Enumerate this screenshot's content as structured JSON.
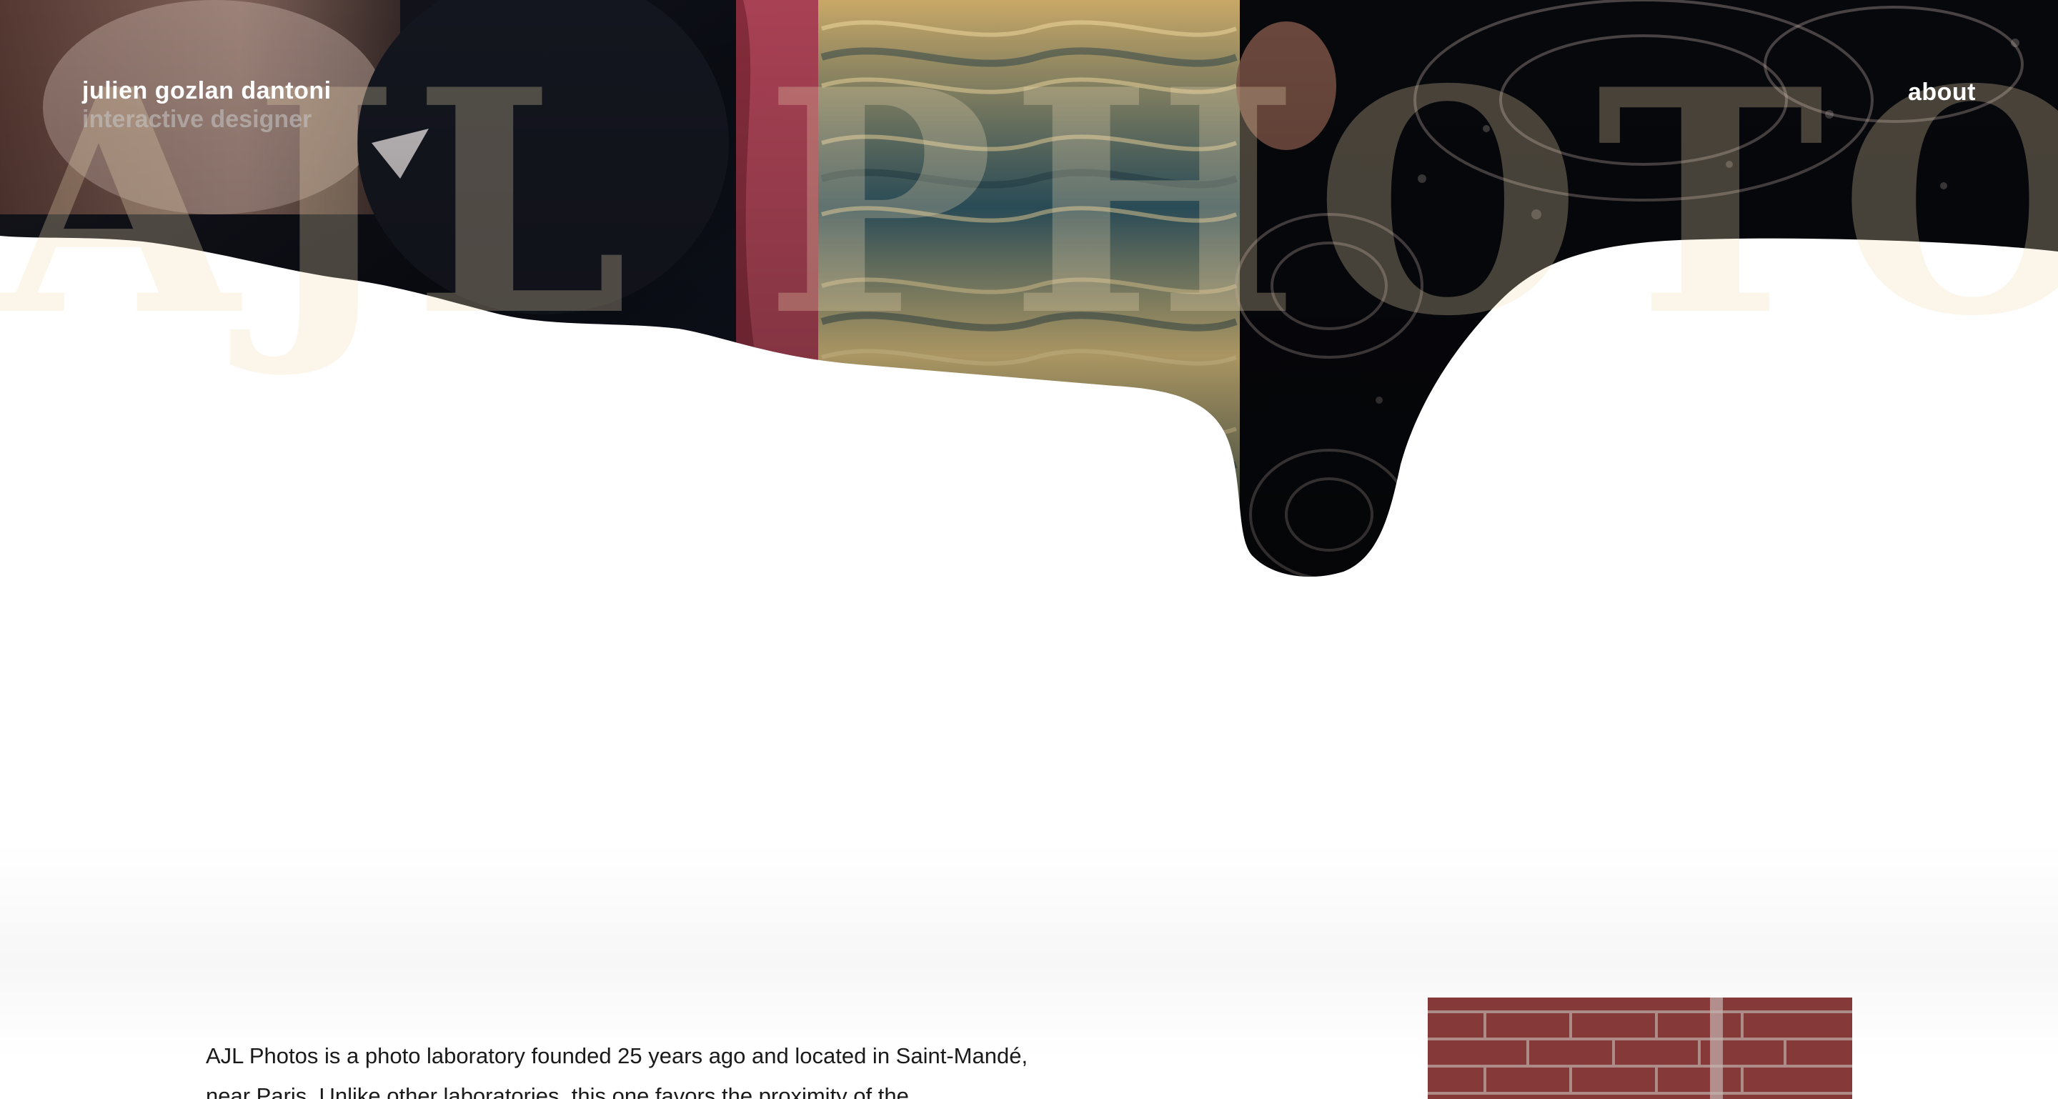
{
  "header": {
    "name": "julien gozlan dantoni",
    "role": "interactive designer",
    "nav_about": "about"
  },
  "hero": {
    "title": "AJL PHOTOS"
  },
  "intro": {
    "text": "AJL Photos is a photo laboratory founded 25 years ago and located in Saint-Mandé, near Paris. Unlike other laboratories, this one favors the proximity of the"
  },
  "colors": {
    "background": "#ffffff",
    "text": "#1a1a1a",
    "header_text": "#ffffff",
    "hero_dark": "#0b0d14",
    "brick": "#8e3e3c"
  }
}
